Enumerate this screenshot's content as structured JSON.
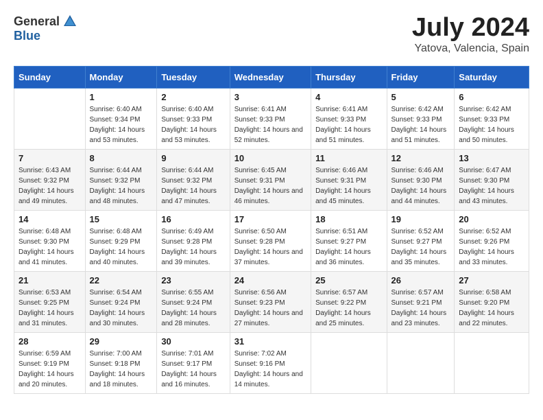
{
  "header": {
    "logo_general": "General",
    "logo_blue": "Blue",
    "month_year": "July 2024",
    "location": "Yatova, Valencia, Spain"
  },
  "calendar": {
    "days_of_week": [
      "Sunday",
      "Monday",
      "Tuesday",
      "Wednesday",
      "Thursday",
      "Friday",
      "Saturday"
    ],
    "weeks": [
      [
        {
          "day": "",
          "sunrise": "",
          "sunset": "",
          "daylight": ""
        },
        {
          "day": "1",
          "sunrise": "Sunrise: 6:40 AM",
          "sunset": "Sunset: 9:34 PM",
          "daylight": "Daylight: 14 hours and 53 minutes."
        },
        {
          "day": "2",
          "sunrise": "Sunrise: 6:40 AM",
          "sunset": "Sunset: 9:33 PM",
          "daylight": "Daylight: 14 hours and 53 minutes."
        },
        {
          "day": "3",
          "sunrise": "Sunrise: 6:41 AM",
          "sunset": "Sunset: 9:33 PM",
          "daylight": "Daylight: 14 hours and 52 minutes."
        },
        {
          "day": "4",
          "sunrise": "Sunrise: 6:41 AM",
          "sunset": "Sunset: 9:33 PM",
          "daylight": "Daylight: 14 hours and 51 minutes."
        },
        {
          "day": "5",
          "sunrise": "Sunrise: 6:42 AM",
          "sunset": "Sunset: 9:33 PM",
          "daylight": "Daylight: 14 hours and 51 minutes."
        },
        {
          "day": "6",
          "sunrise": "Sunrise: 6:42 AM",
          "sunset": "Sunset: 9:33 PM",
          "daylight": "Daylight: 14 hours and 50 minutes."
        }
      ],
      [
        {
          "day": "7",
          "sunrise": "Sunrise: 6:43 AM",
          "sunset": "Sunset: 9:32 PM",
          "daylight": "Daylight: 14 hours and 49 minutes."
        },
        {
          "day": "8",
          "sunrise": "Sunrise: 6:44 AM",
          "sunset": "Sunset: 9:32 PM",
          "daylight": "Daylight: 14 hours and 48 minutes."
        },
        {
          "day": "9",
          "sunrise": "Sunrise: 6:44 AM",
          "sunset": "Sunset: 9:32 PM",
          "daylight": "Daylight: 14 hours and 47 minutes."
        },
        {
          "day": "10",
          "sunrise": "Sunrise: 6:45 AM",
          "sunset": "Sunset: 9:31 PM",
          "daylight": "Daylight: 14 hours and 46 minutes."
        },
        {
          "day": "11",
          "sunrise": "Sunrise: 6:46 AM",
          "sunset": "Sunset: 9:31 PM",
          "daylight": "Daylight: 14 hours and 45 minutes."
        },
        {
          "day": "12",
          "sunrise": "Sunrise: 6:46 AM",
          "sunset": "Sunset: 9:30 PM",
          "daylight": "Daylight: 14 hours and 44 minutes."
        },
        {
          "day": "13",
          "sunrise": "Sunrise: 6:47 AM",
          "sunset": "Sunset: 9:30 PM",
          "daylight": "Daylight: 14 hours and 43 minutes."
        }
      ],
      [
        {
          "day": "14",
          "sunrise": "Sunrise: 6:48 AM",
          "sunset": "Sunset: 9:30 PM",
          "daylight": "Daylight: 14 hours and 41 minutes."
        },
        {
          "day": "15",
          "sunrise": "Sunrise: 6:48 AM",
          "sunset": "Sunset: 9:29 PM",
          "daylight": "Daylight: 14 hours and 40 minutes."
        },
        {
          "day": "16",
          "sunrise": "Sunrise: 6:49 AM",
          "sunset": "Sunset: 9:28 PM",
          "daylight": "Daylight: 14 hours and 39 minutes."
        },
        {
          "day": "17",
          "sunrise": "Sunrise: 6:50 AM",
          "sunset": "Sunset: 9:28 PM",
          "daylight": "Daylight: 14 hours and 37 minutes."
        },
        {
          "day": "18",
          "sunrise": "Sunrise: 6:51 AM",
          "sunset": "Sunset: 9:27 PM",
          "daylight": "Daylight: 14 hours and 36 minutes."
        },
        {
          "day": "19",
          "sunrise": "Sunrise: 6:52 AM",
          "sunset": "Sunset: 9:27 PM",
          "daylight": "Daylight: 14 hours and 35 minutes."
        },
        {
          "day": "20",
          "sunrise": "Sunrise: 6:52 AM",
          "sunset": "Sunset: 9:26 PM",
          "daylight": "Daylight: 14 hours and 33 minutes."
        }
      ],
      [
        {
          "day": "21",
          "sunrise": "Sunrise: 6:53 AM",
          "sunset": "Sunset: 9:25 PM",
          "daylight": "Daylight: 14 hours and 31 minutes."
        },
        {
          "day": "22",
          "sunrise": "Sunrise: 6:54 AM",
          "sunset": "Sunset: 9:24 PM",
          "daylight": "Daylight: 14 hours and 30 minutes."
        },
        {
          "day": "23",
          "sunrise": "Sunrise: 6:55 AM",
          "sunset": "Sunset: 9:24 PM",
          "daylight": "Daylight: 14 hours and 28 minutes."
        },
        {
          "day": "24",
          "sunrise": "Sunrise: 6:56 AM",
          "sunset": "Sunset: 9:23 PM",
          "daylight": "Daylight: 14 hours and 27 minutes."
        },
        {
          "day": "25",
          "sunrise": "Sunrise: 6:57 AM",
          "sunset": "Sunset: 9:22 PM",
          "daylight": "Daylight: 14 hours and 25 minutes."
        },
        {
          "day": "26",
          "sunrise": "Sunrise: 6:57 AM",
          "sunset": "Sunset: 9:21 PM",
          "daylight": "Daylight: 14 hours and 23 minutes."
        },
        {
          "day": "27",
          "sunrise": "Sunrise: 6:58 AM",
          "sunset": "Sunset: 9:20 PM",
          "daylight": "Daylight: 14 hours and 22 minutes."
        }
      ],
      [
        {
          "day": "28",
          "sunrise": "Sunrise: 6:59 AM",
          "sunset": "Sunset: 9:19 PM",
          "daylight": "Daylight: 14 hours and 20 minutes."
        },
        {
          "day": "29",
          "sunrise": "Sunrise: 7:00 AM",
          "sunset": "Sunset: 9:18 PM",
          "daylight": "Daylight: 14 hours and 18 minutes."
        },
        {
          "day": "30",
          "sunrise": "Sunrise: 7:01 AM",
          "sunset": "Sunset: 9:17 PM",
          "daylight": "Daylight: 14 hours and 16 minutes."
        },
        {
          "day": "31",
          "sunrise": "Sunrise: 7:02 AM",
          "sunset": "Sunset: 9:16 PM",
          "daylight": "Daylight: 14 hours and 14 minutes."
        },
        {
          "day": "",
          "sunrise": "",
          "sunset": "",
          "daylight": ""
        },
        {
          "day": "",
          "sunrise": "",
          "sunset": "",
          "daylight": ""
        },
        {
          "day": "",
          "sunrise": "",
          "sunset": "",
          "daylight": ""
        }
      ]
    ]
  }
}
